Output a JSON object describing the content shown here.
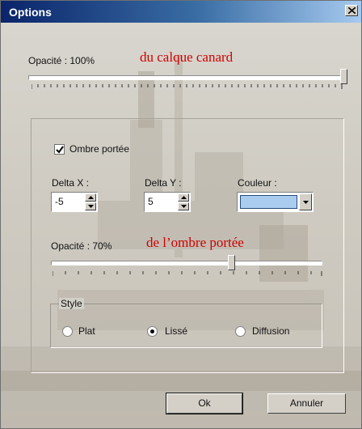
{
  "window": {
    "title": "Options"
  },
  "layer_opacity": {
    "label": "Opacité : 100%",
    "value_percent": 100,
    "annotation": "du calque canard"
  },
  "shadow": {
    "checkbox_label": "Ombre portée",
    "checked": true,
    "delta_x": {
      "label": "Delta X :",
      "value": "-5"
    },
    "delta_y": {
      "label": "Delta Y :",
      "value": "5"
    },
    "color": {
      "label": "Couleur :",
      "value": "#aaccee"
    },
    "opacity": {
      "label": "Opacité : 70%",
      "value_percent": 70,
      "annotation": "de l’ombre portée"
    }
  },
  "style": {
    "title": "Style",
    "options": [
      {
        "label": "Plat",
        "selected": false
      },
      {
        "label": "Lissé",
        "selected": true
      },
      {
        "label": "Diffusion",
        "selected": false
      }
    ]
  },
  "buttons": {
    "ok": "Ok",
    "cancel": "Annuler"
  },
  "colors": {
    "title_bar": "#0a246a",
    "annotation": "#d00000",
    "swatch": "#aaccee"
  },
  "icons": {
    "close": "close-x-icon",
    "spin_up": "triangle-up-icon",
    "spin_down": "triangle-down-icon",
    "dropdown": "chevron-down-icon"
  }
}
